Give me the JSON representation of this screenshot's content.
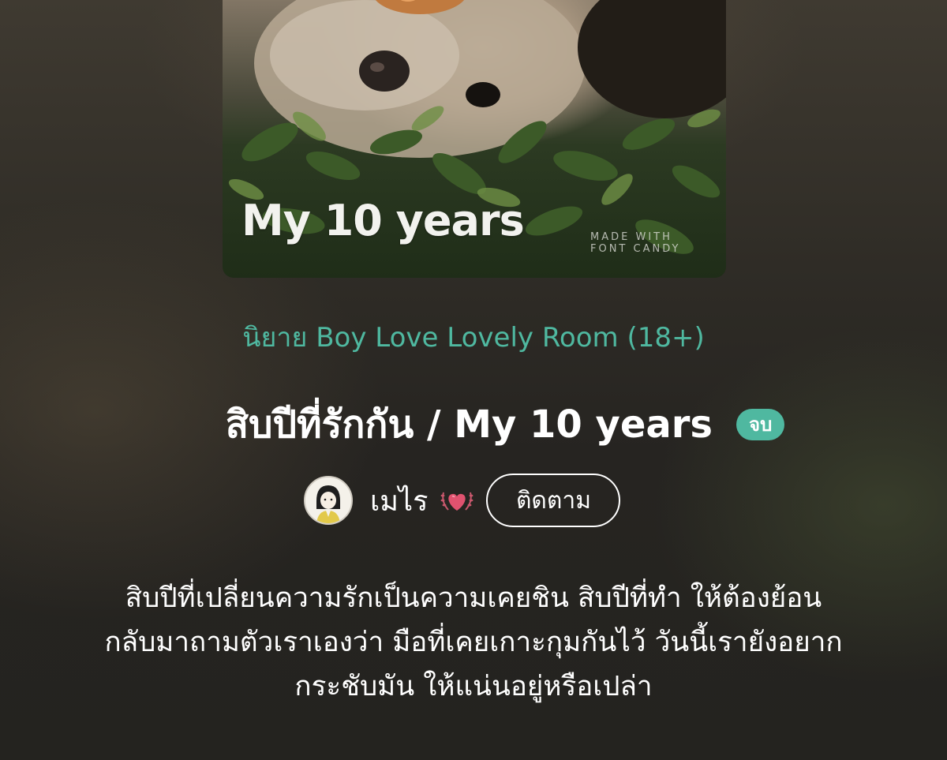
{
  "cover": {
    "title_text": "My 10 years",
    "credit_line1": "MADE WITH",
    "credit_line2": "FONT CANDY"
  },
  "category": "นิยาย Boy Love Lovely Room (18+)",
  "story": {
    "title": "สิบปีที่รักกัน / My 10 years",
    "status": "จบ"
  },
  "author": {
    "name": "เมไร",
    "badge_icon": "heart-laurel-icon",
    "follow_label": "ติดตาม"
  },
  "synopsis": {
    "lines": [
      "สิบปีที่เปลี่ยนความรักเป็นความเคยชิน สิบปีที่ทำ ให้ต้องย้อน",
      "กลับมาถามตัวเราเองว่า มือที่เคยเกาะกุมกันไว้ วันนี้เรายังอยาก",
      "กระชับมัน ให้แน่นอยู่หรือเปล่า"
    ]
  },
  "colors": {
    "accent": "#4fb8a0",
    "text": "#ffffff",
    "heart": "#e0526f"
  }
}
